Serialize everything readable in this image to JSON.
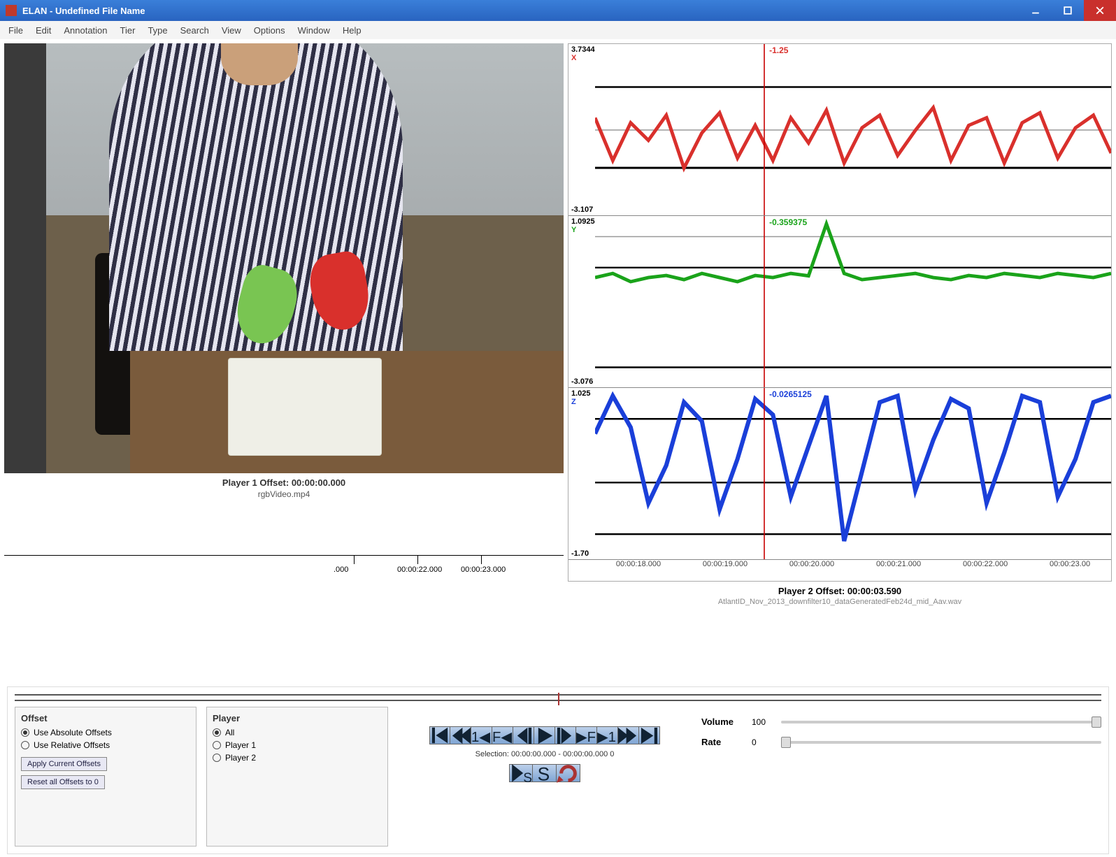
{
  "window": {
    "title": "ELAN - Undefined File Name"
  },
  "menu": [
    "File",
    "Edit",
    "Annotation",
    "Tier",
    "Type",
    "Search",
    "View",
    "Options",
    "Window",
    "Help"
  ],
  "player1": {
    "caption": "Player 1 Offset: 00:00:00.000",
    "file": "rgbVideo.mp4"
  },
  "player2": {
    "caption": "Player 2 Offset: 00:00:03.590",
    "file": "AtlantID_Nov_2013_downfilter10_dataGeneratedFeb24d_mid_Aav.wav"
  },
  "ruler_left": {
    "ticks": [
      ".000",
      "00:00:22.000",
      "00:00:23.000"
    ]
  },
  "time_axis": [
    "00:00:18.000",
    "00:00:19.000",
    "00:00:20.000",
    "00:00:21.000",
    "00:00:22.000",
    "00:00:23.00"
  ],
  "tracks": {
    "x": {
      "letter": "X",
      "top": "3.7344",
      "bot": "-3.107",
      "val": "-1.25",
      "color": "#d9302c"
    },
    "y": {
      "letter": "Y",
      "top": "1.0925",
      "bot": "-3.076",
      "val": "-0.359375",
      "color": "#1aa31a"
    },
    "z": {
      "letter": "Z",
      "top": "1.025",
      "bot": "-1.70",
      "val": "-0.0265125",
      "color": "#1a3fd9"
    }
  },
  "offset_panel": {
    "title": "Offset",
    "opt_abs": "Use Absolute Offsets",
    "opt_rel": "Use Relative Offsets",
    "btn_apply": "Apply Current Offsets",
    "btn_reset": "Reset all Offsets to 0"
  },
  "player_panel": {
    "title": "Player",
    "opt_all": "All",
    "opt_p1": "Player 1",
    "opt_p2": "Player 2"
  },
  "transport": {
    "selection": "Selection: 00:00:00.000 - 00:00:00.000  0"
  },
  "sliders": {
    "volume_label": "Volume",
    "volume_val": "100",
    "rate_label": "Rate",
    "rate_val": "0"
  },
  "chart_data": [
    {
      "type": "line",
      "name": "X",
      "ylim": [
        -3.107,
        3.7344
      ],
      "play_value": -1.25,
      "color": "#d9302c",
      "x": [
        0,
        1,
        2,
        3,
        4,
        5,
        6,
        7,
        8,
        9,
        10,
        11,
        12,
        13,
        14,
        15,
        16,
        17,
        18,
        19,
        20,
        21,
        22,
        23,
        24,
        25,
        26,
        27,
        28,
        29
      ],
      "y": [
        0.8,
        -0.9,
        0.6,
        -0.1,
        0.9,
        -1.2,
        0.2,
        1.0,
        -0.8,
        0.5,
        -0.9,
        0.8,
        -0.2,
        1.1,
        -1.0,
        0.4,
        0.9,
        -0.7,
        0.3,
        1.2,
        -0.9,
        0.5,
        0.8,
        -1.0,
        0.6,
        1.0,
        -0.8,
        0.4,
        0.9,
        -0.6
      ]
    },
    {
      "type": "line",
      "name": "Y",
      "ylim": [
        -3.076,
        1.0925
      ],
      "play_value": -0.359375,
      "color": "#1aa31a",
      "x": [
        0,
        1,
        2,
        3,
        4,
        5,
        6,
        7,
        8,
        9,
        10,
        11,
        12,
        13,
        14,
        15,
        16,
        17,
        18,
        19,
        20,
        21,
        22,
        23,
        24,
        25,
        26,
        27,
        28,
        29
      ],
      "y": [
        -0.4,
        -0.3,
        -0.5,
        -0.4,
        -0.35,
        -0.45,
        -0.3,
        -0.4,
        -0.5,
        -0.35,
        -0.4,
        -0.3,
        -0.36,
        0.9,
        -0.3,
        -0.45,
        -0.4,
        -0.35,
        -0.3,
        -0.4,
        -0.45,
        -0.35,
        -0.4,
        -0.3,
        -0.35,
        -0.4,
        -0.3,
        -0.35,
        -0.4,
        -0.3
      ]
    },
    {
      "type": "line",
      "name": "Z",
      "ylim": [
        -1.7,
        1.025
      ],
      "play_value": -0.0265125,
      "color": "#1a3fd9",
      "x": [
        0,
        1,
        2,
        3,
        4,
        5,
        6,
        7,
        8,
        9,
        10,
        11,
        12,
        13,
        14,
        15,
        16,
        17,
        18,
        19,
        20,
        21,
        22,
        23,
        24,
        25,
        26,
        27,
        28,
        29
      ],
      "y": [
        0.3,
        0.9,
        0.4,
        -0.8,
        -0.2,
        0.8,
        0.5,
        -0.9,
        -0.1,
        0.85,
        0.6,
        -0.7,
        0.1,
        0.9,
        -1.4,
        -0.3,
        0.8,
        0.9,
        -0.6,
        0.2,
        0.85,
        0.7,
        -0.8,
        0.0,
        0.9,
        0.8,
        -0.7,
        -0.1,
        0.8,
        0.9
      ]
    }
  ]
}
